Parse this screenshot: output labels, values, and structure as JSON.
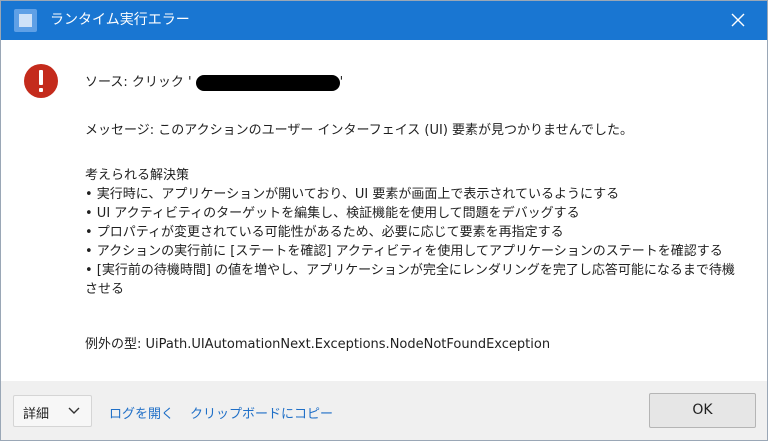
{
  "window": {
    "title": "ランタイム実行エラー",
    "app_icon": "uipath-app-icon",
    "close_icon": "close-icon"
  },
  "body": {
    "error_icon": "error-icon",
    "source_label": "ソース: クリック '",
    "source_value_redacted": true,
    "source_suffix": "'",
    "message": "メッセージ: このアクションのユーザー インターフェイス (UI) 要素が見つかりませんでした。",
    "solutions_title": "考えられる解決策",
    "solutions": [
      "• 実行時に、アプリケーションが開いており、UI 要素が画面上で表示されているようにする",
      "• UI アクティビティのターゲットを編集し、検証機能を使用して問題をデバッグする",
      "• プロパティが変更されている可能性があるため、必要に応じて要素を再指定する",
      "• アクションの実行前に [ステートを確認] アクティビティを使用してアプリケーションのステートを確認する",
      "• [実行前の待機時間] の値を増やし、アプリケーションが完全にレンダリングを完了し応答可能になるまで待機させる"
    ],
    "exception_type": "例外の型: UiPath.UIAutomationNext.Exceptions.NodeNotFoundException"
  },
  "footer": {
    "details_label": "詳細",
    "details_icon": "chevron-down-icon",
    "open_log_link": "ログを開く",
    "copy_link": "クリップボードにコピー",
    "ok_label": "OK"
  },
  "colors": {
    "titlebar": "#1976d2",
    "error_red": "#c42b1c",
    "link_blue": "#1f6fc7",
    "footer_bg": "#f0f0f0"
  }
}
